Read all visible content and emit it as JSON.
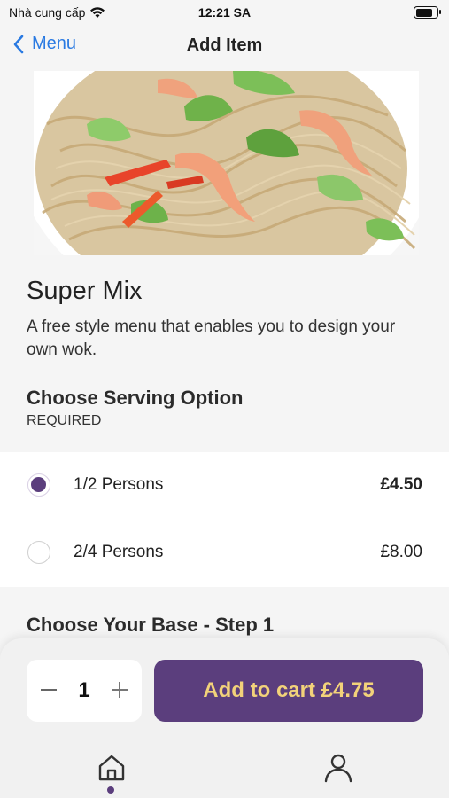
{
  "status_bar": {
    "carrier": "Nhà cung cấp",
    "time": "12:21 SA",
    "battery_level": 0.9
  },
  "nav": {
    "back_label": "Menu",
    "title": "Add Item"
  },
  "product": {
    "name": "Super Mix",
    "description": "A free style menu that enables you to design your own wok."
  },
  "serving_section": {
    "title": "Choose Serving Option",
    "requirement": "REQUIRED",
    "options": [
      {
        "label": "1/2 Persons",
        "price": "£4.50",
        "selected": true
      },
      {
        "label": "2/4 Persons",
        "price": "£8.00",
        "selected": false
      }
    ]
  },
  "base_section": {
    "title": "Choose Your Base - Step 1"
  },
  "cart_bar": {
    "quantity": "1",
    "add_label": "Add to cart £4.75"
  },
  "tabs": [
    {
      "icon": "home-icon",
      "active": true
    },
    {
      "icon": "profile-icon",
      "active": false
    }
  ],
  "colors": {
    "accent": "#5b3e7d",
    "button_text": "#f2d27a",
    "link": "#2a7ae2"
  }
}
